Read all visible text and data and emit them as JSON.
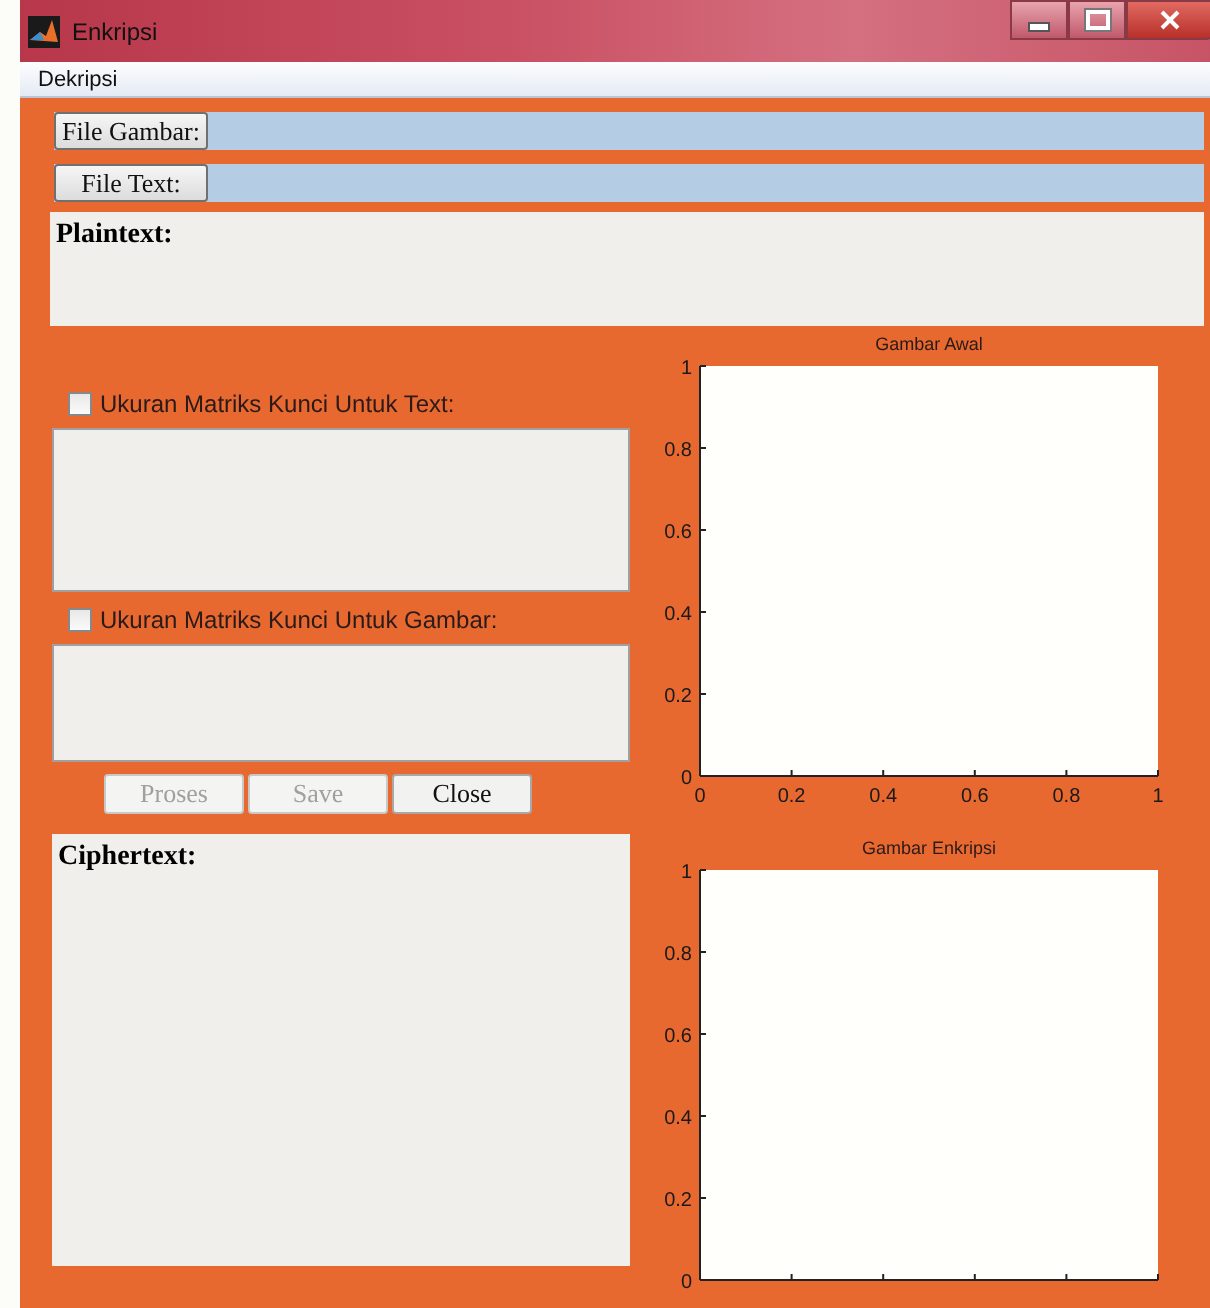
{
  "window": {
    "title": "Enkripsi"
  },
  "menu": [
    {
      "label": "Dekripsi"
    }
  ],
  "file_rows": [
    {
      "button": "File Gambar:"
    },
    {
      "button": "File Text:"
    }
  ],
  "plaintext": {
    "label": "Plaintext:"
  },
  "key_options": [
    {
      "label": "Ukuran Matriks Kunci Untuk Text:",
      "checked": false
    },
    {
      "label": "Ukuran Matriks Kunci Untuk Gambar:",
      "checked": false
    }
  ],
  "buttons": [
    {
      "label": "Proses",
      "disabled": true
    },
    {
      "label": "Save",
      "disabled": true
    },
    {
      "label": "Close",
      "disabled": false
    }
  ],
  "ciphertext": {
    "label": "Ciphertext:"
  },
  "charts": [
    {
      "chart_data": {
        "type": "line",
        "title": "Gambar Awal",
        "xlim": [
          0,
          1
        ],
        "ylim": [
          0,
          1
        ],
        "xticks": [
          0,
          0.2,
          0.4,
          0.6,
          0.8,
          1
        ],
        "yticks": [
          0,
          0.2,
          0.4,
          0.6,
          0.8,
          1
        ]
      }
    },
    {
      "chart_data": {
        "type": "line",
        "title": "Gambar Enkripsi",
        "xlim": [
          0,
          1
        ],
        "ylim": [
          0,
          1
        ],
        "yticks": [
          0,
          0.2,
          0.4,
          0.6,
          0.8,
          1
        ]
      }
    }
  ]
}
